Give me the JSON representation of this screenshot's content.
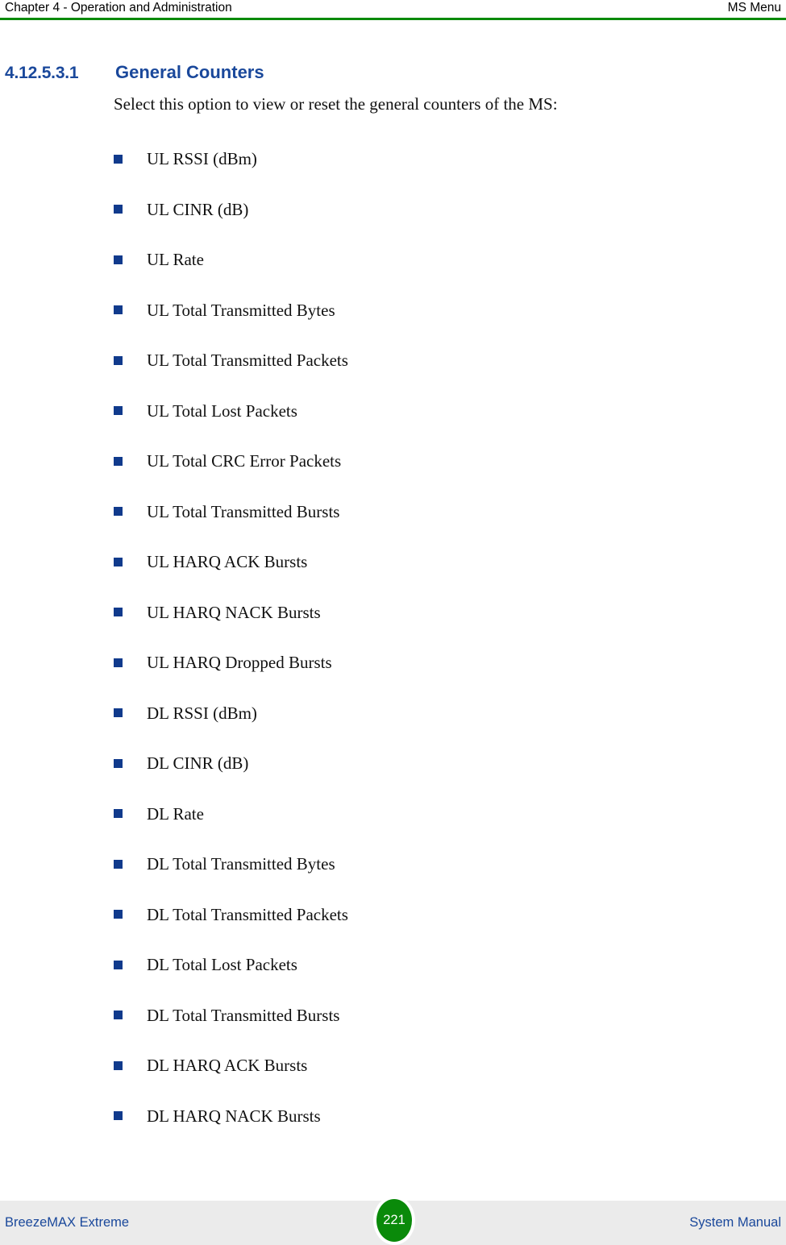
{
  "header": {
    "left": "Chapter 4 - Operation and Administration",
    "right": "MS Menu",
    "rule_color": "#0a8a0a"
  },
  "section": {
    "number": "4.12.5.3.1",
    "title": "General Counters",
    "heading_color": "#1a489b",
    "intro": "Select this option to view or reset the general counters of the MS:"
  },
  "bullet": {
    "color": "#103a8c",
    "icon": "square-bullet-icon"
  },
  "counters": [
    {
      "label": "UL RSSI (dBm)"
    },
    {
      "label": "UL CINR (dB)"
    },
    {
      "label": "UL Rate"
    },
    {
      "label": "UL Total Transmitted Bytes"
    },
    {
      "label": "UL Total Transmitted Packets"
    },
    {
      "label": "UL Total Lost Packets"
    },
    {
      "label": "UL Total CRC Error Packets"
    },
    {
      "label": "UL Total Transmitted Bursts"
    },
    {
      "label": "UL HARQ ACK Bursts"
    },
    {
      "label": "UL HARQ NACK Bursts"
    },
    {
      "label": "UL HARQ Dropped Bursts"
    },
    {
      "label": "DL RSSI (dBm)"
    },
    {
      "label": "DL CINR (dB)"
    },
    {
      "label": "DL Rate"
    },
    {
      "label": "DL Total Transmitted Bytes"
    },
    {
      "label": "DL Total Transmitted Packets"
    },
    {
      "label": "DL Total Lost Packets"
    },
    {
      "label": "DL Total Transmitted Bursts"
    },
    {
      "label": "DL HARQ ACK Bursts"
    },
    {
      "label": "DL HARQ NACK Bursts"
    }
  ],
  "footer": {
    "left": "BreezeMAX Extreme",
    "right": "System Manual",
    "page_number": "221",
    "badge_color": "#0a8a0a",
    "text_color": "#1a489b",
    "background": "#ebebeb"
  }
}
